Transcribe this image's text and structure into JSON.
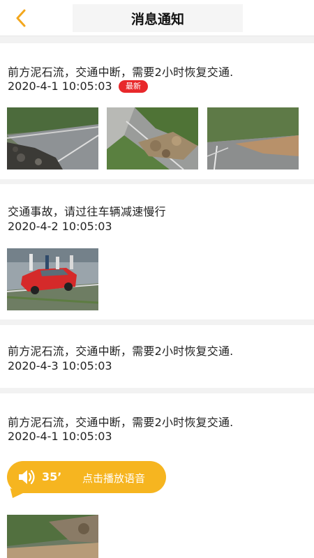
{
  "header": {
    "title": "消息通知",
    "back_icon": "chevron-left-icon",
    "accent_color": "#f3a71d"
  },
  "notifications": [
    {
      "message": "前方泥石流，交通中断，需要2小时恢复交通.",
      "time": "2020-4-1 10:05:03",
      "badge": "最新",
      "photos": [
        "landslide-road-photo",
        "rockfall-highway-photo",
        "mudslide-road-photo"
      ]
    },
    {
      "message": "交通事故，请过往车辆减速慢行",
      "time": "2020-4-2 10:05:03",
      "photos": [
        "car-accident-photo"
      ]
    },
    {
      "message": "前方泥石流，交通中断，需要2小时恢复交通.",
      "time": "2020-4-3 10:05:03"
    },
    {
      "message": "前方泥石流，交通中断，需要2小时恢复交通.",
      "time": "2020-4-1 10:05:03",
      "voice": {
        "icon": "speaker-icon",
        "duration": "35’",
        "label": "点击播放语音"
      },
      "photos": [
        "mudslide-mountain-photo"
      ]
    }
  ],
  "colors": {
    "badge": "#e8282b",
    "voice_bubble": "#f6b520",
    "background": "#f2f2f2"
  }
}
